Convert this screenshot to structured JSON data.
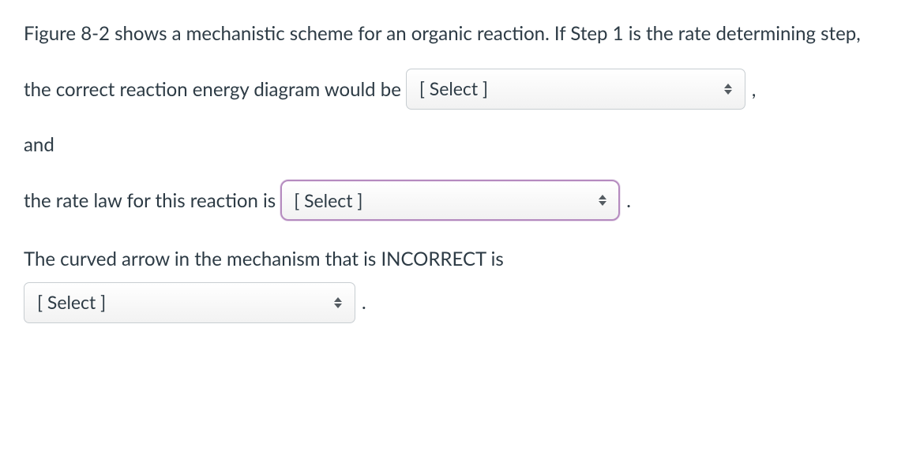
{
  "intro": "Figure 8-2 shows a mechanistic scheme for an organic reaction. If Step 1 is the rate determining step,",
  "line1": {
    "prefix": "the correct reaction energy diagram would be",
    "select_text": "[ Select ]",
    "trailing": ","
  },
  "line2": "and",
  "line3": {
    "prefix": "the rate law for this reaction is",
    "select_text": "[ Select ]",
    "trailing": "."
  },
  "line4": {
    "prefix": "The curved arrow in the mechanism that is INCORRECT is",
    "select_text": "[ Select ]",
    "trailing": "."
  }
}
